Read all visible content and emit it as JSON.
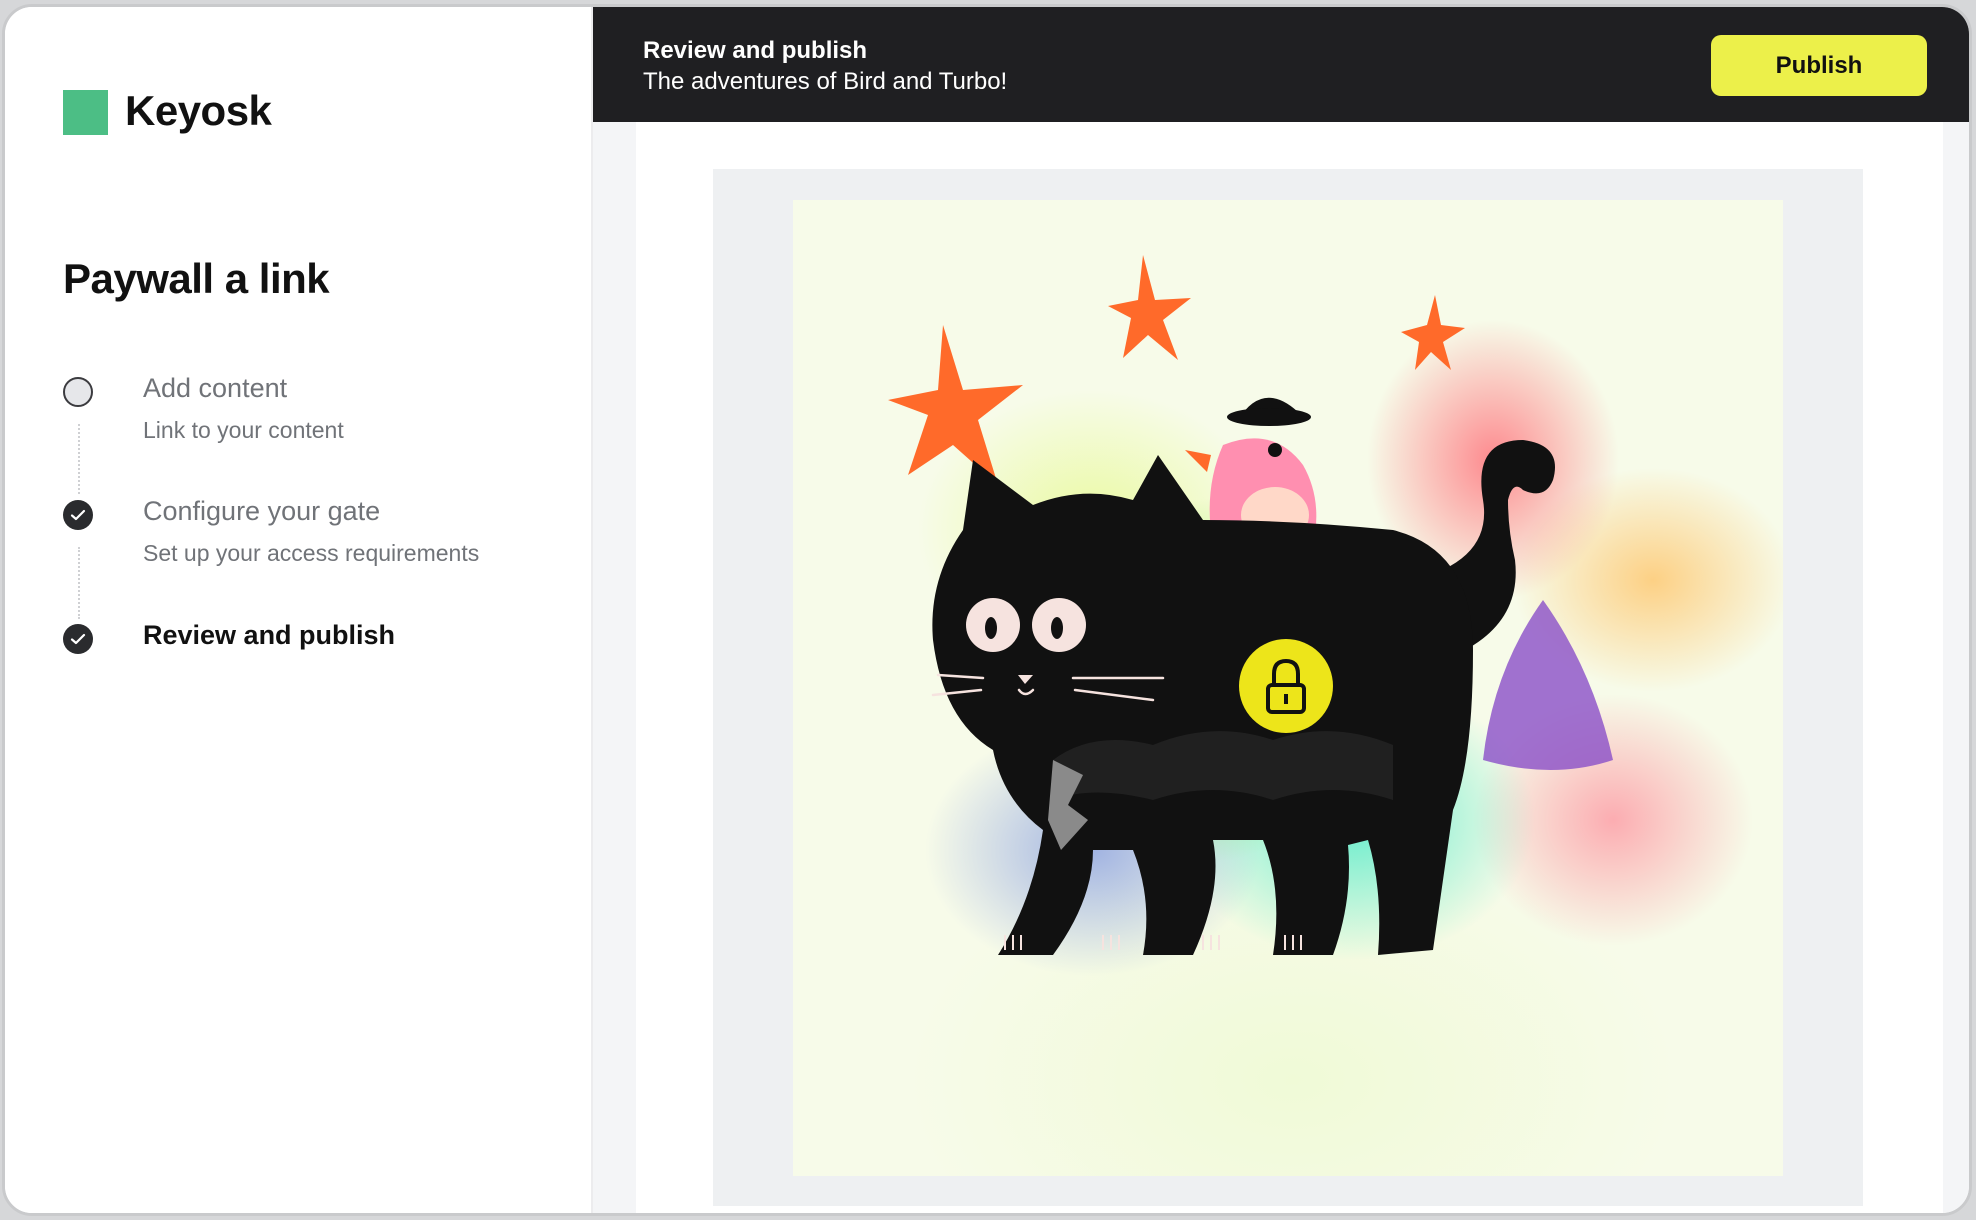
{
  "brand": {
    "name": "Keyosk",
    "accent_color": "#4cbe85"
  },
  "sidebar": {
    "title": "Paywall a link",
    "steps": [
      {
        "title": "Add content",
        "description": "Link to your content",
        "status": "incomplete"
      },
      {
        "title": "Configure your gate",
        "description": "Set up your access requirements",
        "status": "complete"
      },
      {
        "title": "Review and publish",
        "description": "",
        "status": "current"
      }
    ]
  },
  "header": {
    "title": "Review and publish",
    "subtitle": "The adventures of Bird and Turbo!",
    "publish_label": "Publish",
    "publish_color": "#ecf04a"
  },
  "preview": {
    "image_description_icon": "lock-icon"
  }
}
